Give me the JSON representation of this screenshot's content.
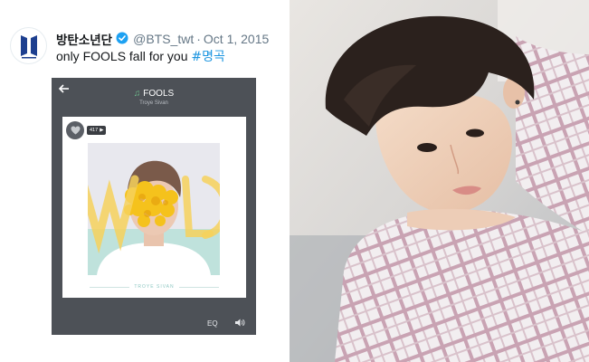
{
  "tweet": {
    "display_name": "방탄소년단",
    "handle": "@BTS_twt",
    "separator": "·",
    "date": "Oct 1, 2015",
    "text": "only FOOLS fall for you ",
    "hashtag": "#명곡",
    "avatar_icon": "bts-logo-icon",
    "verified_icon": "verified-badge-icon",
    "verified_color": "#1da1f2"
  },
  "player": {
    "song_title": "FOOLS",
    "artist": "Troye Sivan",
    "like_count": "417",
    "like_arrow": "▶",
    "cover_artist": "TROYE SIVAN",
    "eq_label": "EQ",
    "back_icon": "back-arrow-icon",
    "heart_icon": "heart-icon",
    "volume_icon": "speaker-icon",
    "song_icon": "note-icon",
    "accent": "#6ec08f"
  }
}
